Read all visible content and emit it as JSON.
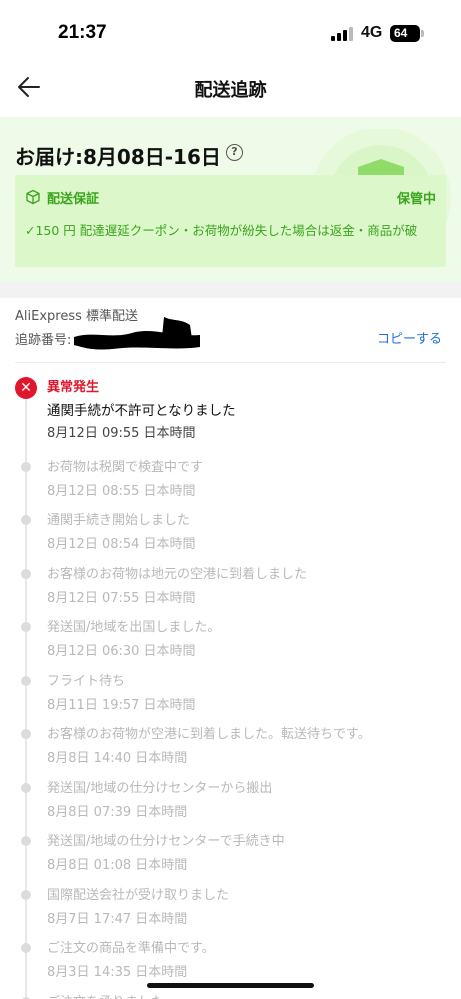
{
  "status_bar": {
    "time": "21:37",
    "network": "4G",
    "battery": "64"
  },
  "nav": {
    "title": "配送追跡",
    "back_icon": "arrow-left-icon"
  },
  "delivery": {
    "title": "お届け:8月08日-16日",
    "help_glyph": "?",
    "guarantee": {
      "title": "配送保証",
      "status": "保管中",
      "description": "✓150 円 配達遅延クーポン・お荷物が紛失した場合は返金・商品が破"
    },
    "colors": {
      "card_bg": "#effbe9",
      "accent": "#3aa51d"
    }
  },
  "shipment": {
    "carrier": "AliExpress 標準配送",
    "tracking_label": "追跡番号:",
    "copy_label": "コピーする"
  },
  "timeline": {
    "current": {
      "headline": "異常発生",
      "status": "通関手続が不許可となりました",
      "time": "8月12日 09:55 日本時間",
      "icon": "close-icon",
      "color": "#e0162c"
    },
    "events": [
      {
        "status": "お荷物は税関で検査中です",
        "time": "8月12日 08:55 日本時間"
      },
      {
        "status": "通関手続き開始しました",
        "time": "8月12日 08:54 日本時間"
      },
      {
        "status": "お客様のお荷物は地元の空港に到着しました",
        "time": "8月12日 07:55 日本時間"
      },
      {
        "status": "発送国/地域を出国しました。",
        "time": "8月12日 06:30 日本時間"
      },
      {
        "status": "フライト待ち",
        "time": "8月11日 19:57 日本時間"
      },
      {
        "status": "お客様のお荷物が空港に到着しました。転送待ちです。",
        "time": "8月8日 14:40 日本時間"
      },
      {
        "status": "発送国/地域の仕分けセンターから搬出",
        "time": "8月8日 07:39 日本時間"
      },
      {
        "status": "発送国/地域の仕分けセンターで手続き中",
        "time": "8月8日 01:08 日本時間"
      },
      {
        "status": "国際配送会社が受け取りました",
        "time": "8月7日 17:47 日本時間"
      },
      {
        "status": "ご注文の商品を準備中です。",
        "time": "8月3日 14:35 日本時間"
      },
      {
        "status": "ご注文を承りました。",
        "time": ""
      }
    ]
  }
}
